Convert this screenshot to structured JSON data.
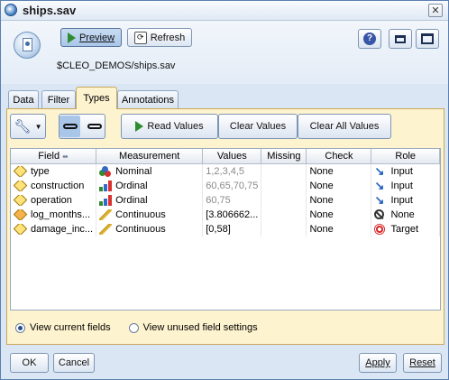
{
  "window": {
    "title": "ships.sav",
    "close_glyph": "✕"
  },
  "toolbar": {
    "preview_label": "Preview",
    "refresh_label": "Refresh",
    "help_glyph": "?"
  },
  "source": {
    "path": "$CLEO_DEMOS/ships.sav"
  },
  "tabs": [
    {
      "label": "Data",
      "active": false
    },
    {
      "label": "Filter",
      "active": false
    },
    {
      "label": "Types",
      "active": true
    },
    {
      "label": "Annotations",
      "active": false
    }
  ],
  "types_toolbar": {
    "read_values_label": "Read Values",
    "clear_values_label": "Clear Values",
    "clear_all_values_label": "Clear All Values"
  },
  "table": {
    "columns": [
      "Field",
      "Measurement",
      "Values",
      "Missing",
      "Check",
      "Role"
    ],
    "rows": [
      {
        "field": "type",
        "measurement": "Nominal",
        "values": "1,2,3,4,5",
        "missing": "",
        "check": "None",
        "role": "Input"
      },
      {
        "field": "construction",
        "measurement": "Ordinal",
        "values": "60,65,70,75",
        "missing": "",
        "check": "None",
        "role": "Input"
      },
      {
        "field": "operation",
        "measurement": "Ordinal",
        "values": "60,75",
        "missing": "",
        "check": "None",
        "role": "Input"
      },
      {
        "field": "log_months...",
        "measurement": "Continuous",
        "values": "[3.806662...",
        "missing": "",
        "check": "None",
        "role": "None"
      },
      {
        "field": "damage_inc...",
        "measurement": "Continuous",
        "values": "[0,58]",
        "missing": "",
        "check": "None",
        "role": "Target"
      }
    ]
  },
  "view_options": {
    "current_label": "View current fields",
    "unused_label": "View unused field settings",
    "selected": "current"
  },
  "footer": {
    "ok_label": "OK",
    "cancel_label": "Cancel",
    "apply_label": "Apply",
    "reset_label": "Reset"
  },
  "colors": {
    "panel": "#fef3cf",
    "window_bg": "#dbe6f4",
    "role_input": "#1f5fbf",
    "role_target": "#d92b2b"
  }
}
